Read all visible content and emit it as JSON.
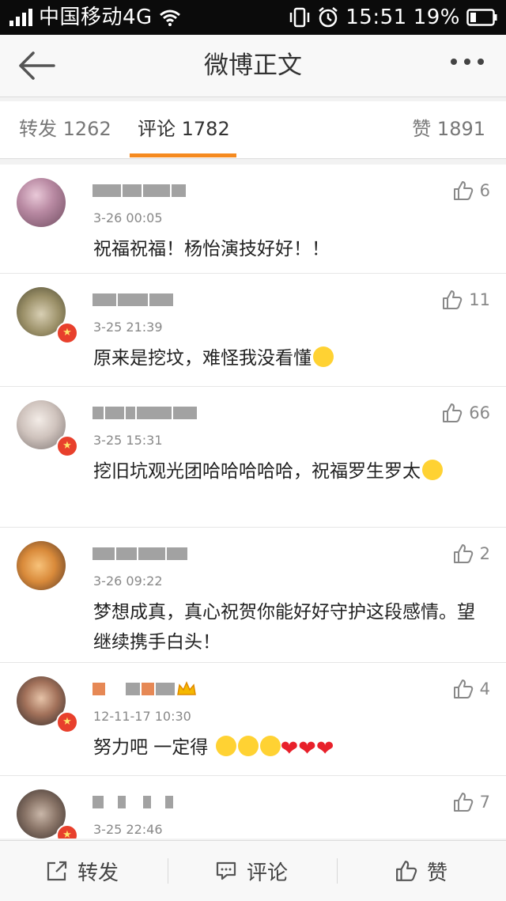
{
  "status_bar": {
    "carrier": "中国移动4G",
    "time": "15:51",
    "battery": "19%"
  },
  "nav": {
    "title": "微博正文"
  },
  "tabs": [
    {
      "label": "转发",
      "count": "1262"
    },
    {
      "label": "评论",
      "count": "1782"
    },
    {
      "label": "赞",
      "count": "1891"
    }
  ],
  "comments": [
    {
      "time": "3-26 00:05",
      "text": "祝福祝福！杨怡演技好好！！",
      "likes": "6"
    },
    {
      "time": "3-25 21:39",
      "text": "原来是挖坟，难怪我没看懂",
      "likes": "11"
    },
    {
      "time": "3-25 15:31",
      "text": "挖旧坑观光团哈哈哈哈哈，祝福罗生罗太",
      "likes": "66"
    },
    {
      "time": "3-26 09:22",
      "text": "梦想成真，真心祝贺你能好好守护这段感情。望继续携手白头！",
      "likes": "2"
    },
    {
      "time": "12-11-17 10:30",
      "text": "努力吧 一定得",
      "likes": "4"
    },
    {
      "time": "3-25 22:46",
      "text": "",
      "likes": "7"
    }
  ],
  "bottom_bar": {
    "repost": "转发",
    "comment": "评论",
    "like": "赞"
  },
  "colors": {
    "accent": "#f58a1f",
    "verified_badge": "#e8402c"
  }
}
